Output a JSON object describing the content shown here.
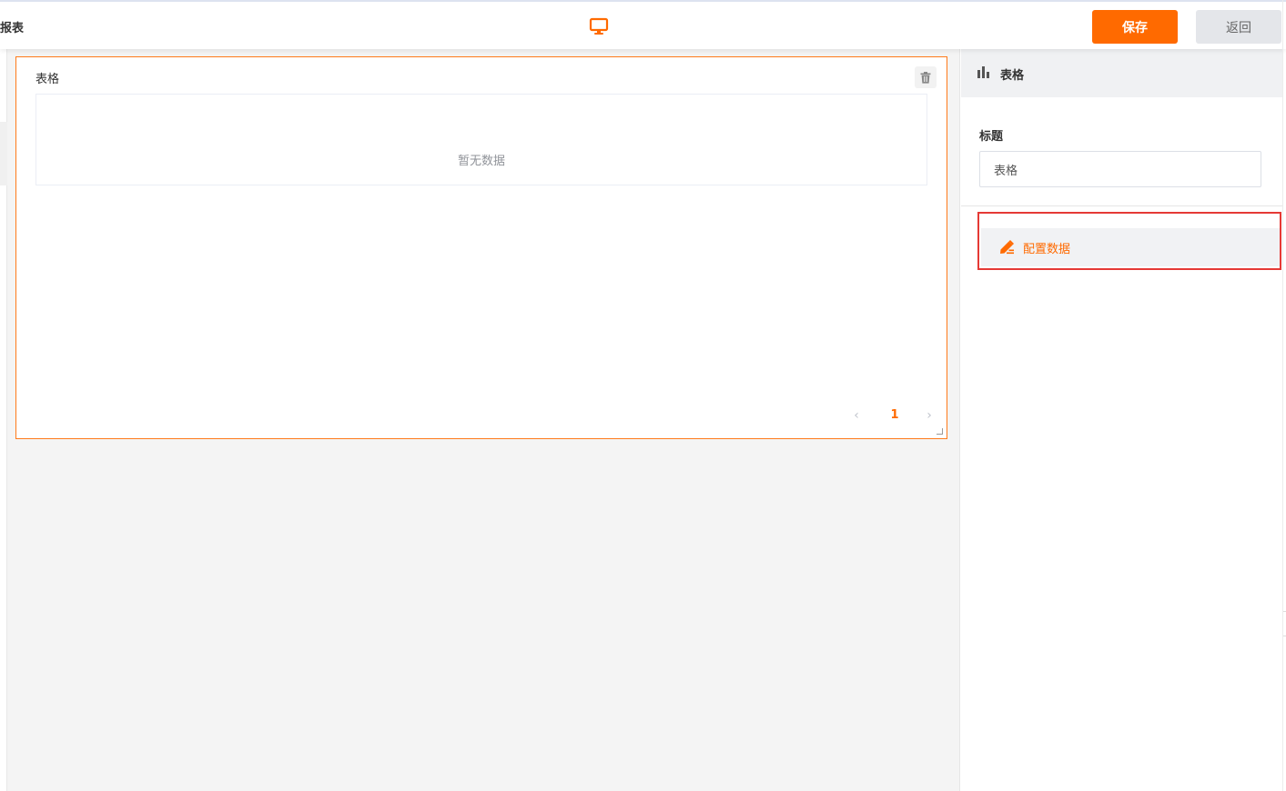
{
  "header": {
    "page_title": "报表",
    "device_icon": "desktop-monitor-icon",
    "save_label": "保存",
    "back_label": "返回"
  },
  "widget": {
    "title": "表格",
    "empty_text": "暂无数据",
    "delete_icon": "trash-icon",
    "pagination": {
      "prev_icon": "chevron-left-icon",
      "current_page": "1",
      "next_icon": "chevron-right-icon"
    }
  },
  "panel": {
    "header_icon": "bar-chart-icon",
    "header_label": "表格",
    "title_field_label": "标题",
    "title_field_value": "表格",
    "config_data_icon": "edit-pen-icon",
    "config_data_label": "配置数据"
  },
  "colors": {
    "accent": "#ff6a00",
    "highlight_box": "#e53935",
    "canvas_bg": "#f4f4f4",
    "panel_header_bg": "#f0f1f3"
  }
}
